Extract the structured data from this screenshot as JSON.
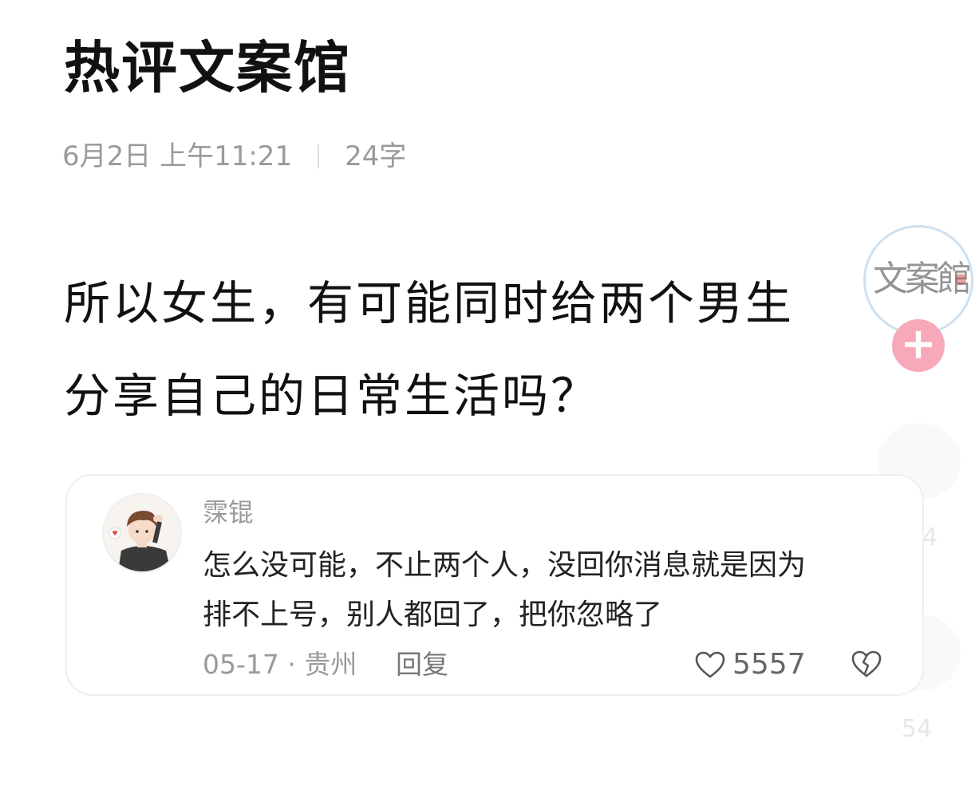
{
  "page": {
    "title": "热评文案馆",
    "meta": {
      "date": "6月2日 上午11:21",
      "word_count": "24字"
    },
    "question_lines": [
      "所以女生，有可能同时给两个男生",
      "分享自己的日常生活吗？"
    ]
  },
  "side": {
    "stamp_text": "文案館",
    "follow_label": "+",
    "ghost_count_1": "244",
    "ghost_count_2": "54"
  },
  "comment": {
    "username": "霂锟",
    "text_lines": [
      "怎么没可能，不止两个人，没回你消息就是因为",
      "排不上号，别人都回了，把你忽略了"
    ],
    "date_location": "05-17 · 贵州",
    "reply_label": "回复",
    "like_count": "5557"
  },
  "colors": {
    "follow_button": "#f7a9b9",
    "meta_text": "#9a9a9a",
    "card_border": "#eeeeee"
  },
  "icons": [
    "heart-icon",
    "broken-heart-icon",
    "plus-icon"
  ]
}
